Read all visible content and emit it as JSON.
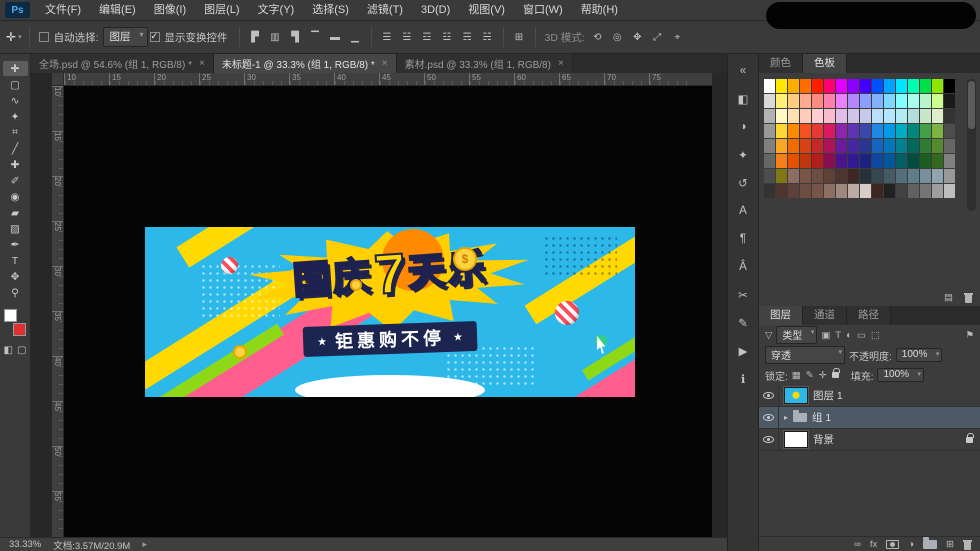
{
  "app": {
    "logo": "Ps"
  },
  "menu": {
    "items": [
      "文件(F)",
      "编辑(E)",
      "图像(I)",
      "图层(L)",
      "文字(Y)",
      "选择(S)",
      "滤镜(T)",
      "3D(D)",
      "视图(V)",
      "窗口(W)",
      "帮助(H)"
    ]
  },
  "options": {
    "tool_glyph": "✛",
    "auto_select_label": "自动选择:",
    "auto_select_value": "图层",
    "show_transform_label": "显示变换控件",
    "align_icons": [
      {
        "name": "align-left-icon",
        "glyph": "▛"
      },
      {
        "name": "align-h-center-icon",
        "glyph": "▥"
      },
      {
        "name": "align-right-icon",
        "glyph": "▜"
      },
      {
        "name": "align-top-icon",
        "glyph": "▔"
      },
      {
        "name": "align-v-center-icon",
        "glyph": "▬"
      },
      {
        "name": "align-bottom-icon",
        "glyph": "▁"
      }
    ],
    "distribute_icons": [
      {
        "name": "distribute-top-icon",
        "glyph": "☰"
      },
      {
        "name": "distribute-v-center-icon",
        "glyph": "☱"
      },
      {
        "name": "distribute-bottom-icon",
        "glyph": "☲"
      },
      {
        "name": "distribute-left-icon",
        "glyph": "☳"
      },
      {
        "name": "distribute-h-center-icon",
        "glyph": "☴"
      },
      {
        "name": "distribute-right-icon",
        "glyph": "☵"
      }
    ],
    "extra_icon": {
      "name": "auto-align-layers-icon",
      "glyph": "⊞"
    },
    "mode_label": "3D 模式:",
    "mode_icons": [
      {
        "name": "3d-rotate-icon",
        "glyph": "⟲"
      },
      {
        "name": "3d-roll-icon",
        "glyph": "◎"
      },
      {
        "name": "3d-pan-icon",
        "glyph": "✥"
      },
      {
        "name": "3d-slide-icon",
        "glyph": "⤢"
      },
      {
        "name": "3d-scale-icon",
        "glyph": "⌖"
      }
    ]
  },
  "tabs": [
    {
      "label": "全场.psd @ 54.6% (组 1, RGB/8) *",
      "active": false
    },
    {
      "label": "未标题-1 @ 33.3% (组 1, RGB/8) *",
      "active": true
    },
    {
      "label": "素材.psd @ 33.3% (组 1, RGB/8)",
      "active": false
    }
  ],
  "tools": [
    {
      "name": "move-tool",
      "glyph": "✛",
      "active": true
    },
    {
      "name": "rectangular-marquee-tool",
      "glyph": "▢",
      "active": false
    },
    {
      "name": "lasso-tool",
      "glyph": "∿",
      "active": false
    },
    {
      "name": "quick-selection-tool",
      "glyph": "✦",
      "active": false
    },
    {
      "name": "crop-tool",
      "glyph": "⌗",
      "active": false
    },
    {
      "name": "eyedropper-tool",
      "glyph": "╱",
      "active": false
    },
    {
      "name": "spot-healing-brush-tool",
      "glyph": "✚",
      "active": false
    },
    {
      "name": "brush-tool",
      "glyph": "✐",
      "active": false
    },
    {
      "name": "clone-stamp-tool",
      "glyph": "◉",
      "active": false
    },
    {
      "name": "eraser-tool",
      "glyph": "▰",
      "active": false
    },
    {
      "name": "gradient-tool",
      "glyph": "▨",
      "active": false
    },
    {
      "name": "pen-tool",
      "glyph": "✒",
      "active": false
    },
    {
      "name": "type-tool",
      "glyph": "T",
      "active": false
    },
    {
      "name": "hand-tool",
      "glyph": "✥",
      "active": false
    },
    {
      "name": "zoom-tool",
      "glyph": "⚲",
      "active": false
    }
  ],
  "toolbar_extra": {
    "foreground_color": "#ffffff",
    "background_color": "#e03131",
    "quick_mask_glyph": "◧",
    "screen_mode_glyph": "▢"
  },
  "rulers": {
    "horizontal": [
      10,
      15,
      20,
      25,
      30,
      35,
      40,
      45,
      50,
      55,
      60,
      65,
      70,
      75
    ],
    "vertical": [
      10,
      15,
      20,
      25,
      30,
      35,
      40,
      45,
      50,
      55
    ]
  },
  "banner": {
    "title_pre": "国庆",
    "title_num": "7",
    "title_post": "天乐",
    "subtitle": "钜惠购不停",
    "star": "★",
    "coin_symbol": "$",
    "bg_color": "#2cb9e9",
    "stripe_yellow": "#ffd900",
    "stripe_pink": "#ff5e8e",
    "stripe_green": "#8fd818"
  },
  "right_strip": {
    "icons": [
      {
        "name": "expand-panels-icon",
        "glyph": "«"
      },
      {
        "name": "color-panel-icon",
        "glyph": "◧"
      },
      {
        "name": "adjustments-panel-icon",
        "glyph": "◑"
      },
      {
        "name": "styles-panel-icon",
        "glyph": "✦"
      },
      {
        "name": "history-panel-icon",
        "glyph": "↺"
      },
      {
        "name": "character-panel-icon",
        "glyph": "A"
      },
      {
        "name": "paragraph-panel-icon",
        "glyph": "¶"
      },
      {
        "name": "glyphs-panel-icon",
        "glyph": "Â"
      },
      {
        "name": "clone-source-panel-icon",
        "glyph": "✂"
      },
      {
        "name": "brush-settings-panel-icon",
        "glyph": "✎"
      },
      {
        "name": "timeline-panel-icon",
        "glyph": "▶"
      },
      {
        "name": "info-panel-icon",
        "glyph": "ℹ"
      }
    ]
  },
  "swatches_panel": {
    "tabs": [
      {
        "label": "颜色",
        "active": false
      },
      {
        "label": "色板",
        "active": true
      }
    ],
    "colors": [
      [
        "#ffffff",
        "#ffe800",
        "#ffae00",
        "#ff6d00",
        "#ff1e00",
        "#ff006e",
        "#e100ff",
        "#8c00ff",
        "#4400ff",
        "#0050ff",
        "#00a2ff",
        "#00e5ff",
        "#00ffb0",
        "#00e049",
        "#8ce600",
        "#000000"
      ],
      [
        "#d9d9d9",
        "#fff176",
        "#ffcc80",
        "#ffab91",
        "#ff8a80",
        "#ff80ab",
        "#ea80fc",
        "#b388ff",
        "#8c9eff",
        "#82b1ff",
        "#80d8ff",
        "#84ffff",
        "#a7ffeb",
        "#b9f6ca",
        "#ccff90",
        "#1a1a1a"
      ],
      [
        "#b3b3b3",
        "#fff9c4",
        "#ffe0b2",
        "#ffccbc",
        "#ffcdd2",
        "#f8bbd0",
        "#e1bee7",
        "#d1c4e9",
        "#c5cae9",
        "#bbdefb",
        "#b3e5fc",
        "#b2ebf2",
        "#b2dfdb",
        "#c8e6c9",
        "#dcedc8",
        "#333333"
      ],
      [
        "#999999",
        "#fdd835",
        "#fb8c00",
        "#f4511e",
        "#e53935",
        "#d81b60",
        "#8e24aa",
        "#5e35b1",
        "#3949ab",
        "#1e88e5",
        "#039be5",
        "#00acc1",
        "#00897b",
        "#43a047",
        "#7cb342",
        "#4d4d4d"
      ],
      [
        "#808080",
        "#f9a825",
        "#ef6c00",
        "#d84315",
        "#c62828",
        "#ad1457",
        "#6a1b9a",
        "#4527a0",
        "#283593",
        "#1565c0",
        "#0277bd",
        "#00838f",
        "#00695c",
        "#2e7d32",
        "#558b2f",
        "#666666"
      ],
      [
        "#666666",
        "#f57f17",
        "#e65100",
        "#bf360c",
        "#b71c1c",
        "#880e4f",
        "#4a148c",
        "#311b92",
        "#1a237e",
        "#0d47a1",
        "#01579b",
        "#006064",
        "#004d40",
        "#1b5e20",
        "#33691e",
        "#808080"
      ],
      [
        "#4d4d4d",
        "#827717",
        "#8d6e63",
        "#795548",
        "#6d4c41",
        "#5d4037",
        "#4e342e",
        "#3e2723",
        "#263238",
        "#37474f",
        "#455a64",
        "#546e7a",
        "#607d8b",
        "#78909c",
        "#90a4ae",
        "#999999"
      ],
      [
        "#333333",
        "#4e342e",
        "#5d4037",
        "#6d4c41",
        "#795548",
        "#8d6e63",
        "#a1887f",
        "#bcaaa4",
        "#d7ccc8",
        "#3e2723",
        "#212121",
        "#424242",
        "#616161",
        "#757575",
        "#9e9e9e",
        "#bdbdbd"
      ]
    ]
  },
  "swatches_footer": [
    {
      "name": "new-swatch-icon",
      "glyph": "▤"
    },
    {
      "name": "delete-swatch-icon",
      "glyph": "css-trash"
    }
  ],
  "layers_panel": {
    "tabs": [
      {
        "label": "图层",
        "active": true
      },
      {
        "label": "通道",
        "active": false
      },
      {
        "label": "路径",
        "active": false
      }
    ],
    "filter_kind_glyph": "▽",
    "filter_value": "类型",
    "filter_icons": [
      {
        "name": "filter-pixel-layers-icon",
        "glyph": "▣"
      },
      {
        "name": "filter-type-layers-icon",
        "glyph": "T"
      },
      {
        "name": "filter-adjustment-layers-icon",
        "glyph": "◐"
      },
      {
        "name": "filter-shape-layers-icon",
        "glyph": "▭"
      },
      {
        "name": "filter-smart-objects-icon",
        "glyph": "⬚"
      }
    ],
    "filter_toggle_glyph": "⚑",
    "blend_mode": "穿透",
    "opacity_label": "不透明度:",
    "opacity_value": "100%",
    "lock_label": "锁定:",
    "lock_icons": [
      {
        "name": "lock-transparent-pixels-icon",
        "glyph": "▦"
      },
      {
        "name": "lock-image-pixels-icon",
        "glyph": "✎"
      },
      {
        "name": "lock-position-icon",
        "glyph": "✛"
      },
      {
        "name": "lock-all-icon",
        "glyph": "css-lock"
      }
    ],
    "fill_label": "填充:",
    "fill_value": "100%",
    "layers": [
      {
        "name": "图层 1",
        "type": "image",
        "selected": false,
        "locked": false
      },
      {
        "name": "组 1",
        "type": "group",
        "selected": true,
        "locked": false
      },
      {
        "name": "背景",
        "type": "background",
        "selected": false,
        "locked": true
      }
    ],
    "bottom_icons": [
      {
        "name": "link-layers-icon",
        "glyph": "∞"
      },
      {
        "name": "layer-effects-icon",
        "glyph": "fx"
      },
      {
        "name": "layer-mask-icon",
        "glyph": "css-mask"
      },
      {
        "name": "adjustment-layer-icon",
        "glyph": "◑"
      },
      {
        "name": "new-group-icon",
        "glyph": "css-folder"
      },
      {
        "name": "new-layer-icon",
        "glyph": "⊞"
      },
      {
        "name": "delete-layer-icon",
        "glyph": "css-trash"
      }
    ]
  },
  "statusbar": {
    "zoom": "33.33%",
    "doc_info": "文档:3.57M/20.9M",
    "arrow": "▸"
  }
}
